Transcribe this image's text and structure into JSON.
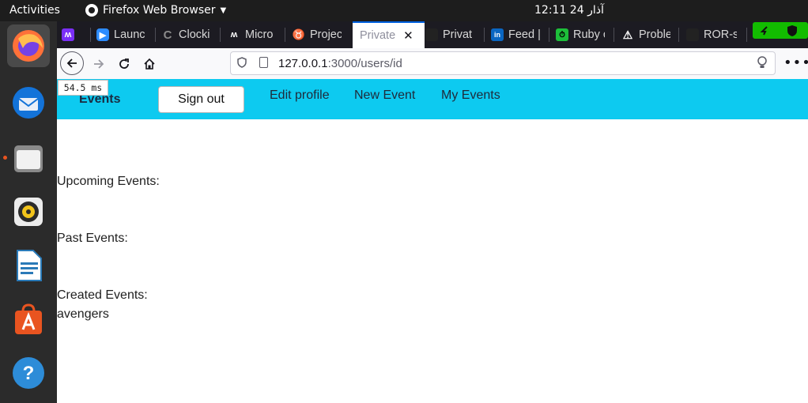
{
  "os": {
    "activities": "Activities",
    "app_name": "Firefox Web Browser",
    "clock": "12:11  آذار 24"
  },
  "dock": {
    "items": [
      {
        "name": "firefox",
        "active": true
      },
      {
        "name": "thunderbird"
      },
      {
        "name": "files"
      },
      {
        "name": "rhythmbox"
      },
      {
        "name": "libreoffice-writer"
      },
      {
        "name": "software-center"
      },
      {
        "name": "help"
      }
    ]
  },
  "browser": {
    "tabs": [
      {
        "label": "",
        "icon": "miro-icon",
        "color": "#7b2ff7"
      },
      {
        "label": "Launc",
        "icon": "zoom-icon",
        "color": "#2d8cff"
      },
      {
        "label": "Clocki",
        "icon": "clockify-icon",
        "color": "#8a8a8a"
      },
      {
        "label": "Micro",
        "icon": "microverse-icon",
        "color": "#ffffff"
      },
      {
        "label": "Projec",
        "icon": "project-icon",
        "color": "#e8b04a"
      },
      {
        "label": "Private",
        "icon": "",
        "color": "",
        "active": true
      },
      {
        "label": "Privat",
        "icon": "github-icon",
        "color": "#2b2b2b"
      },
      {
        "label": "Feed |",
        "icon": "linkedin-icon",
        "color": "#0a66c2"
      },
      {
        "label": "Ruby c",
        "icon": "ruby-timer-icon",
        "color": "#1dbf3a"
      },
      {
        "label": "Proble",
        "icon": "warning-icon",
        "color": "#ffffff"
      },
      {
        "label": "ROR-s",
        "icon": "github-icon",
        "color": "#2b2b2b"
      }
    ],
    "url_host": "127.0.0.1",
    "url_path": ":3000/users/id",
    "timing_badge": "54.5 ms"
  },
  "site": {
    "brand": "Events",
    "sign_out": "Sign out",
    "links": [
      "Edit profile",
      "New Event",
      "My Events"
    ],
    "accent": "#0dcaf0"
  },
  "content": {
    "upcoming_label": "Upcoming Events:",
    "past_label": "Past Events:",
    "created_label": "Created Events:",
    "created_items": [
      "avengers"
    ]
  }
}
